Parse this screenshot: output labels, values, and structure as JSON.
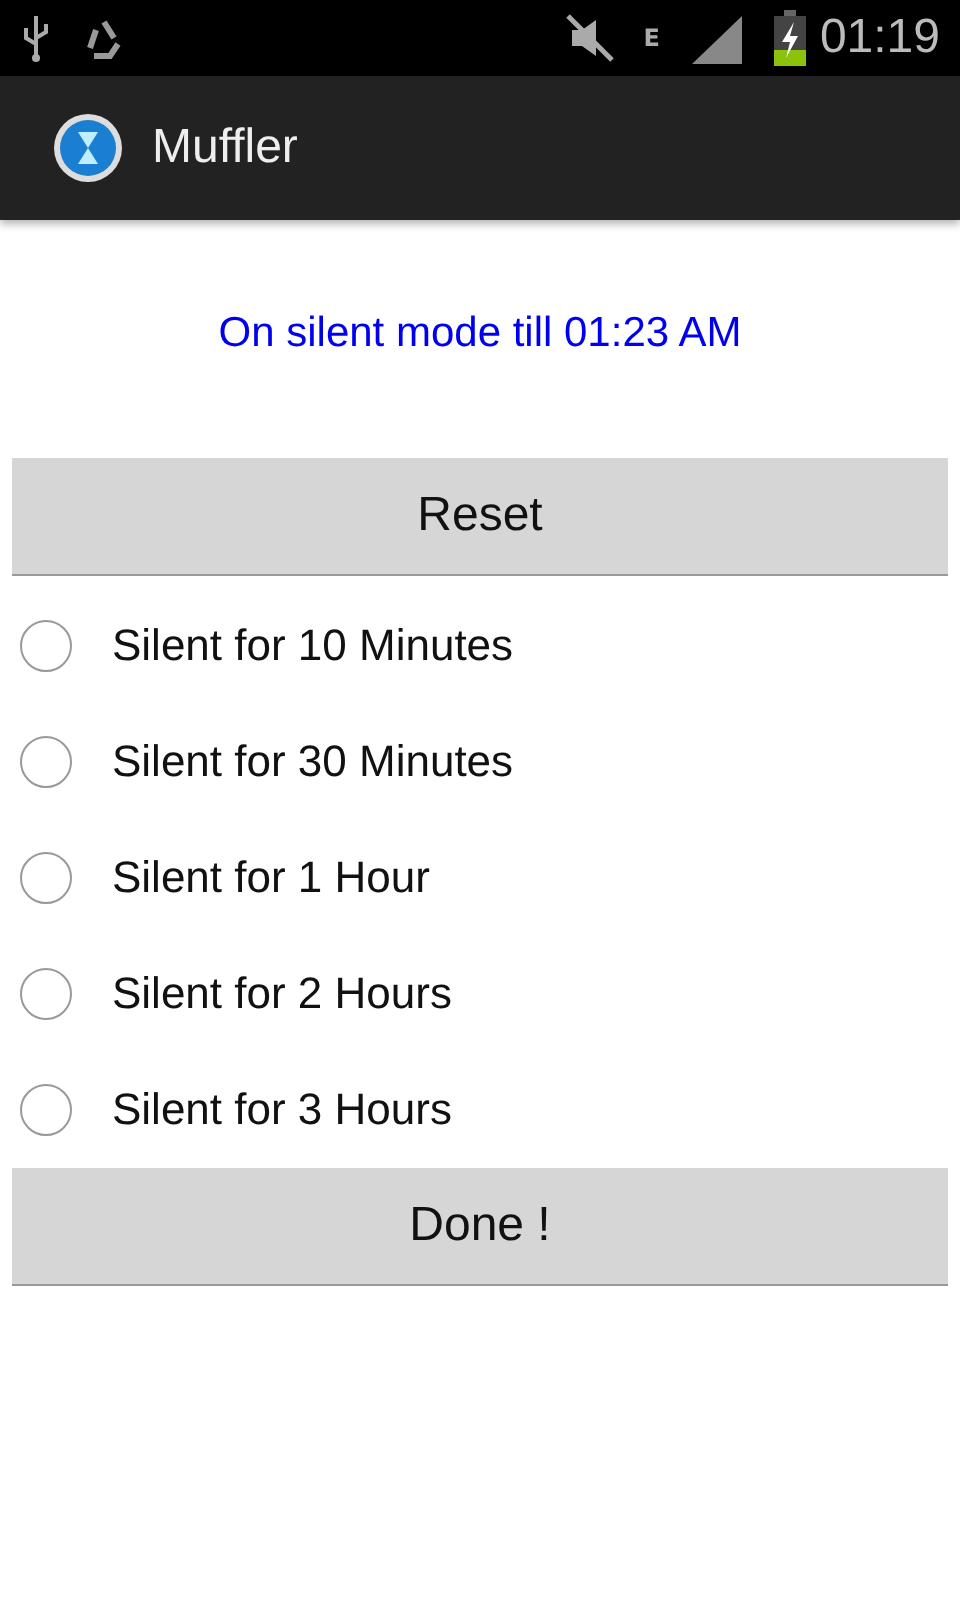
{
  "status_bar": {
    "network_type": "E",
    "time": "01:19"
  },
  "action_bar": {
    "title": "Muffler"
  },
  "status_message": "On silent mode till 01:23 AM",
  "reset_button": "Reset",
  "options": [
    {
      "label": "Silent for 10 Minutes",
      "selected": false
    },
    {
      "label": "Silent for 30 Minutes",
      "selected": false
    },
    {
      "label": "Silent for 1 Hour",
      "selected": false
    },
    {
      "label": "Silent for 2 Hours",
      "selected": false
    },
    {
      "label": "Silent for 3 Hours",
      "selected": false
    }
  ],
  "done_button": "Done !"
}
